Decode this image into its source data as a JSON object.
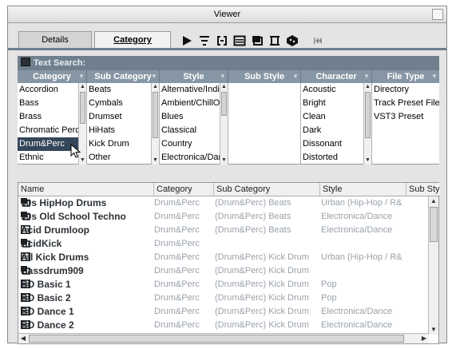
{
  "window": {
    "title": "Viewer"
  },
  "tabs": [
    {
      "label": "Details",
      "active": false
    },
    {
      "label": "Category",
      "active": true
    }
  ],
  "toolbar_icons": [
    "play-icon",
    "filter-icon",
    "bracket-icon",
    "list-icon",
    "disk-icon",
    "table-icon",
    "dice-icon",
    "rewind-icon"
  ],
  "search": {
    "label": "Text Search:"
  },
  "columns": [
    {
      "label": "Category"
    },
    {
      "label": "Sub Category"
    },
    {
      "label": "Style"
    },
    {
      "label": "Sub Style"
    },
    {
      "label": "Character"
    },
    {
      "label": "File Type"
    }
  ],
  "lists": {
    "category": [
      "Accordion",
      "Bass",
      "Brass",
      "Chromatic Perc",
      "Drum&Perc",
      "Ethnic"
    ],
    "category_selected": "Drum&Perc",
    "subcategory": [
      "Beats",
      "Cymbals",
      "Drumset",
      "HiHats",
      "Kick Drum",
      "Other"
    ],
    "style": [
      "Alternative/Indie",
      "Ambient/ChillOut",
      "Blues",
      "Classical",
      "Country",
      "Electronica/Dance"
    ],
    "substyle": [],
    "character": [
      "Acoustic",
      "Bright",
      "Clean",
      "Dark",
      "Dissonant",
      "Distorted"
    ],
    "filetype": [
      "Directory",
      "Track Preset File",
      "VST3 Preset"
    ]
  },
  "results": {
    "headers": [
      "Name",
      "Category",
      "Sub Category",
      "Style",
      "Sub Style"
    ],
    "rows": [
      {
        "icon": "disk-icon",
        "name": "90s HipHop Drums",
        "category": "Drum&Perc",
        "subcategory": "(Drum&Perc) Beats",
        "style": "Urban (Hip-Hop / R&"
      },
      {
        "icon": "disk-icon",
        "name": "90s Old School Techno",
        "category": "Drum&Perc",
        "subcategory": "(Drum&Perc) Beats",
        "style": "Electronica/Dance"
      },
      {
        "icon": "list-icon",
        "name": "Acid Drumloop",
        "category": "Drum&Perc",
        "subcategory": "(Drum&Perc) Beats",
        "style": "Electronica/Dance"
      },
      {
        "icon": "disk-icon",
        "name": "AcidKick",
        "category": "Drum&Perc",
        "subcategory": "",
        "style": ""
      },
      {
        "icon": "list-icon",
        "name": "All Kick Drums",
        "category": "Drum&Perc",
        "subcategory": "(Drum&Perc) Kick Drum",
        "style": "Urban (Hip-Hop / R&"
      },
      {
        "icon": "disk-icon",
        "name": "Bassdrum909",
        "category": "Drum&Perc",
        "subcategory": "(Drum&Perc) Kick Drum",
        "style": ""
      },
      {
        "icon": "list-icon",
        "name": "BD Basic 1",
        "category": "Drum&Perc",
        "subcategory": "(Drum&Perc) Kick Drum",
        "style": "Pop"
      },
      {
        "icon": "list-icon",
        "name": "BD Basic 2",
        "category": "Drum&Perc",
        "subcategory": "(Drum&Perc) Kick Drum",
        "style": "Pop"
      },
      {
        "icon": "list-icon",
        "name": "BD Dance 1",
        "category": "Drum&Perc",
        "subcategory": "(Drum&Perc) Kick Drum",
        "style": "Electronica/Dance"
      },
      {
        "icon": "list-icon",
        "name": "BD Dance 2",
        "category": "Drum&Perc",
        "subcategory": "(Drum&Perc) Kick Drum",
        "style": "Electronica/Dance"
      }
    ]
  },
  "colors": {
    "header_bar": "#6f7f8d",
    "column_header": "#8696a4",
    "selection": "#34465a",
    "dim_text": "#9aa2aa"
  }
}
